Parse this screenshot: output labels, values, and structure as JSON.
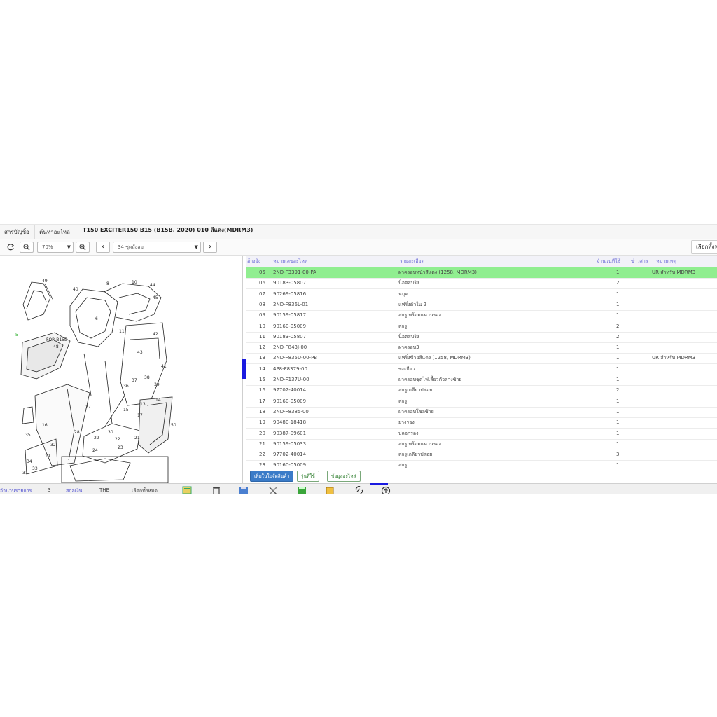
{
  "header": {
    "tabs": [
      {
        "label": "สารบัญชิ้อ"
      },
      {
        "label": "ค้นหาอะไหล่"
      }
    ],
    "title": "T150 EXCITER150 B15 (B15B, 2020) 010 สีแดง(MDRM3)"
  },
  "toolbar": {
    "zoom_value": "70%",
    "page_select": "34 ชุดถังลม",
    "right_button": "เลือกทั้งหม"
  },
  "diagram": {
    "labels": [
      "49",
      "40",
      "8",
      "10",
      "44",
      "45",
      "6",
      "11",
      "48",
      "FOR B15D",
      "5",
      "42",
      "41",
      "43",
      "36",
      "37",
      "38",
      "40",
      "39",
      "14",
      "13",
      "27",
      "15",
      "17",
      "28",
      "29",
      "30",
      "22",
      "23",
      "24",
      "21",
      "16",
      "35",
      "19",
      "34",
      "33",
      "31",
      "32",
      "50",
      "5"
    ]
  },
  "table": {
    "columns": [
      "อ้างอิง",
      "หมายเลขอะไหล่",
      "รายละเอียด",
      "จำนวนที่ใช้",
      "ข่าวสาร",
      "หมายเหตุ"
    ],
    "rows": [
      {
        "ref": "05",
        "part": "2ND-F3391-00-PA",
        "desc": "ฝาครอบหน้าสีแดง (1258, MDRM3)",
        "qty": "1",
        "note": "UR สำหรับ MDRM3",
        "highlight": true
      },
      {
        "ref": "06",
        "part": "90183-05807",
        "desc": "น็อตสปริง",
        "qty": "2",
        "note": ""
      },
      {
        "ref": "07",
        "part": "90269-05816",
        "desc": "หมุด",
        "qty": "1",
        "note": ""
      },
      {
        "ref": "08",
        "part": "2ND-F836L-01",
        "desc": "แฟริ่งตัวใน 2",
        "qty": "1",
        "note": ""
      },
      {
        "ref": "09",
        "part": "90159-05817",
        "desc": "สกรู พร้อมแหวนรอง",
        "qty": "1",
        "note": ""
      },
      {
        "ref": "10",
        "part": "90160-05009",
        "desc": "สกรู",
        "qty": "2",
        "note": ""
      },
      {
        "ref": "11",
        "part": "90183-05807",
        "desc": "น็อตสปริง",
        "qty": "2",
        "note": ""
      },
      {
        "ref": "12",
        "part": "2ND-F843J-00",
        "desc": "ฝาครอบ3",
        "qty": "1",
        "note": ""
      },
      {
        "ref": "13",
        "part": "2ND-F835U-00-PB",
        "desc": "แฟริ่งซ้ายสีแดง (1258, MDRM3)",
        "qty": "1",
        "note": "UR สำหรับ MDRM3"
      },
      {
        "ref": "14",
        "part": "4P8-F8379-00",
        "desc": "ขอเกี่ยว",
        "qty": "1",
        "note": ""
      },
      {
        "ref": "15",
        "part": "2ND-F137U-00",
        "desc": "ฝาครอบชุดไฟเลี้ยวตัวล่างซ้าย",
        "qty": "1",
        "note": ""
      },
      {
        "ref": "16",
        "part": "97702-40014",
        "desc": "สกรูเกลียวปล่อย",
        "qty": "2",
        "note": ""
      },
      {
        "ref": "17",
        "part": "90160-05009",
        "desc": "สกรู",
        "qty": "1",
        "note": ""
      },
      {
        "ref": "18",
        "part": "2ND-F8385-00",
        "desc": "ฝาครอบโซลซ้าย",
        "qty": "1",
        "note": ""
      },
      {
        "ref": "19",
        "part": "90480-18418",
        "desc": "ยางรอง",
        "qty": "1",
        "note": ""
      },
      {
        "ref": "20",
        "part": "90387-09601",
        "desc": "ปลอกรอง",
        "qty": "1",
        "note": ""
      },
      {
        "ref": "21",
        "part": "90159-05033",
        "desc": "สกรู พร้อมแหวนรอง",
        "qty": "1",
        "note": ""
      },
      {
        "ref": "22",
        "part": "97702-40014",
        "desc": "สกรูเกลียวปล่อย",
        "qty": "3",
        "note": ""
      },
      {
        "ref": "23",
        "part": "90160-05009",
        "desc": "สกรู",
        "qty": "1",
        "note": ""
      }
    ]
  },
  "actions": {
    "add_to_cart": "เพิ่มในใบจัดสินค้า",
    "where_used": "รุ่นที่ใช้",
    "part_info": "ข้อมูลอะไหล่"
  },
  "footer": {
    "items_label": "จำนวนรายการ",
    "items_count": "3",
    "currency_label": "สกุลเงิน",
    "currency": "THB",
    "select_all": "เลือกทั้งหมด"
  },
  "colors": {
    "highlight_row": "#90ee90",
    "primary": "#3a7bc8",
    "link": "#6b6bd6"
  }
}
